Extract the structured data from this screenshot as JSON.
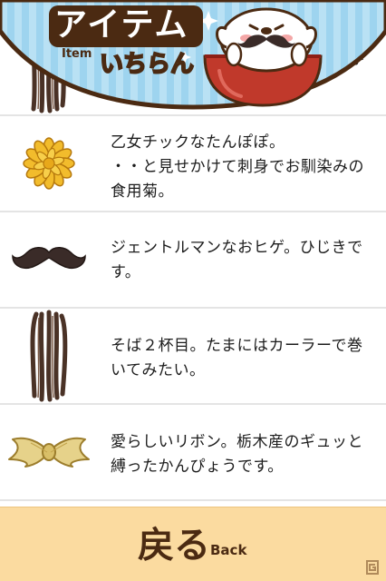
{
  "header": {
    "title_main": "アイテム",
    "title_sub": "いちらん",
    "title_en": "Item"
  },
  "items": [
    {
      "icon": "soba-icon",
      "desc": "か"
    },
    {
      "icon": "chrysanthemum-icon",
      "desc": "乙女チックなたんぽぽ。\n・・と見せかけて刺身でお馴染みの食用菊。"
    },
    {
      "icon": "mustache-icon",
      "desc": "ジェントルマンなおヒゲ。ひじきです。"
    },
    {
      "icon": "soba-icon",
      "desc": "そば２杯目。たまにはカーラーで巻いてみたい。"
    },
    {
      "icon": "ribbon-icon",
      "desc": "愛らしいリボン。栃木産のギュッと縛ったかんぴょうです。"
    }
  ],
  "footer": {
    "back_label": "戻る",
    "back_label_en": "Back",
    "background": "#fbdba0"
  },
  "watermark": "G"
}
